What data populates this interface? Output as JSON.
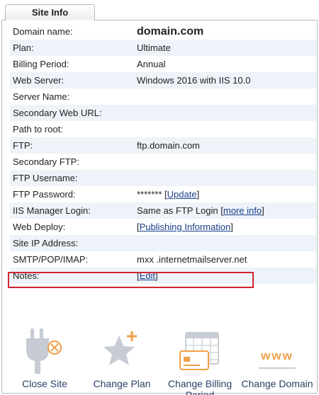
{
  "tab": {
    "label": "Site Info"
  },
  "rows": [
    {
      "label": "Domain name:",
      "value": "domain.com"
    },
    {
      "label": "Plan:",
      "value": "Ultimate"
    },
    {
      "label": "Billing Period:",
      "value": "Annual"
    },
    {
      "label": "Web Server:",
      "value": "Windows 2016 with IIS 10.0"
    },
    {
      "label": "Server Name:",
      "value": ""
    },
    {
      "label": "Secondary Web URL:",
      "value": ""
    },
    {
      "label": "Path to root:",
      "value": ""
    },
    {
      "label": "FTP:",
      "value": "ftp.domain.com"
    },
    {
      "label": "Secondary FTP:",
      "value": ""
    },
    {
      "label": "FTP Username:",
      "value": ""
    },
    {
      "label": "FTP Password:",
      "value": "*******",
      "link": "Update"
    },
    {
      "label": "IIS Manager Login:",
      "value": "Same as FTP Login",
      "link": "more info"
    },
    {
      "label": "Web Deploy:",
      "link": "Publishing Information"
    },
    {
      "label": "Site IP Address:",
      "value": ""
    },
    {
      "label": "SMTP/POP/IMAP:",
      "value": "mxx .internetmailserver.net"
    },
    {
      "label": "Notes:",
      "link": "Edit"
    }
  ],
  "actions": [
    {
      "label": "Close Site",
      "icon": "close-site-icon"
    },
    {
      "label": "Change Plan",
      "icon": "change-plan-icon"
    },
    {
      "label": "Change Billing Period",
      "icon": "calendar-card-icon"
    },
    {
      "label": "Change Domain",
      "icon": "www-icon"
    }
  ],
  "colors": {
    "row_alt": "#edf3f9",
    "link": "#1a3f8c",
    "highlight": "#d0262f",
    "action_label": "#2a3f66",
    "accent_orange": "#f0a048"
  }
}
